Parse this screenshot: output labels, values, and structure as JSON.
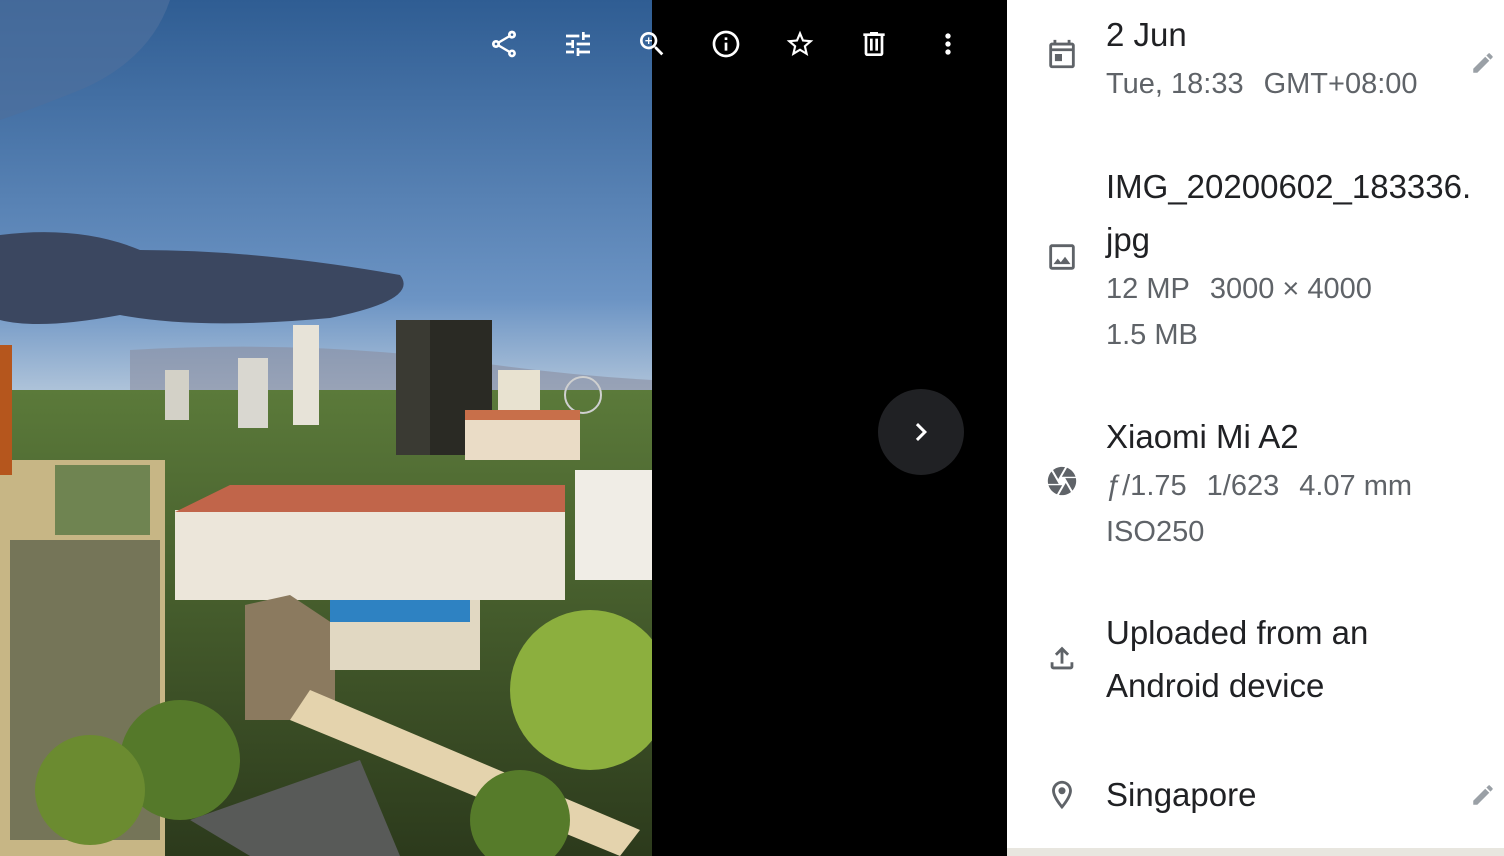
{
  "toolbar": {
    "items": [
      {
        "name": "share-icon",
        "label": "Share"
      },
      {
        "name": "edit-adjust-icon",
        "label": "Edit"
      },
      {
        "name": "zoom-in-icon",
        "label": "Zoom"
      },
      {
        "name": "info-icon",
        "label": "Info"
      },
      {
        "name": "star-icon",
        "label": "Favourite"
      },
      {
        "name": "delete-icon",
        "label": "Delete"
      },
      {
        "name": "more-options-icon",
        "label": "More options"
      }
    ]
  },
  "viewer": {
    "next_icon": "chevron-right-icon",
    "photo_description": "City skyline at sunset"
  },
  "details": {
    "date": {
      "day": "2 Jun",
      "time": "Tue, 18:33",
      "timezone": "GMT+08:00"
    },
    "file": {
      "name_line1": "IMG_20200602_183336.",
      "name_line2": "jpg",
      "megapixels": "12 MP",
      "dimensions": "3000 × 4000",
      "size": "1.5 MB"
    },
    "camera": {
      "model": "Xiaomi Mi A2",
      "aperture": "ƒ/1.75",
      "shutter": "1/623",
      "focal": "4.07 mm",
      "iso": "ISO250"
    },
    "upload": {
      "line1": "Uploaded from an",
      "line2": "Android device"
    },
    "location": {
      "place": "Singapore"
    }
  },
  "colors": {
    "panel_bg": "#ffffff",
    "icon_grey": "#5f6368",
    "text_primary": "#202124",
    "viewer_bg": "#000000"
  }
}
